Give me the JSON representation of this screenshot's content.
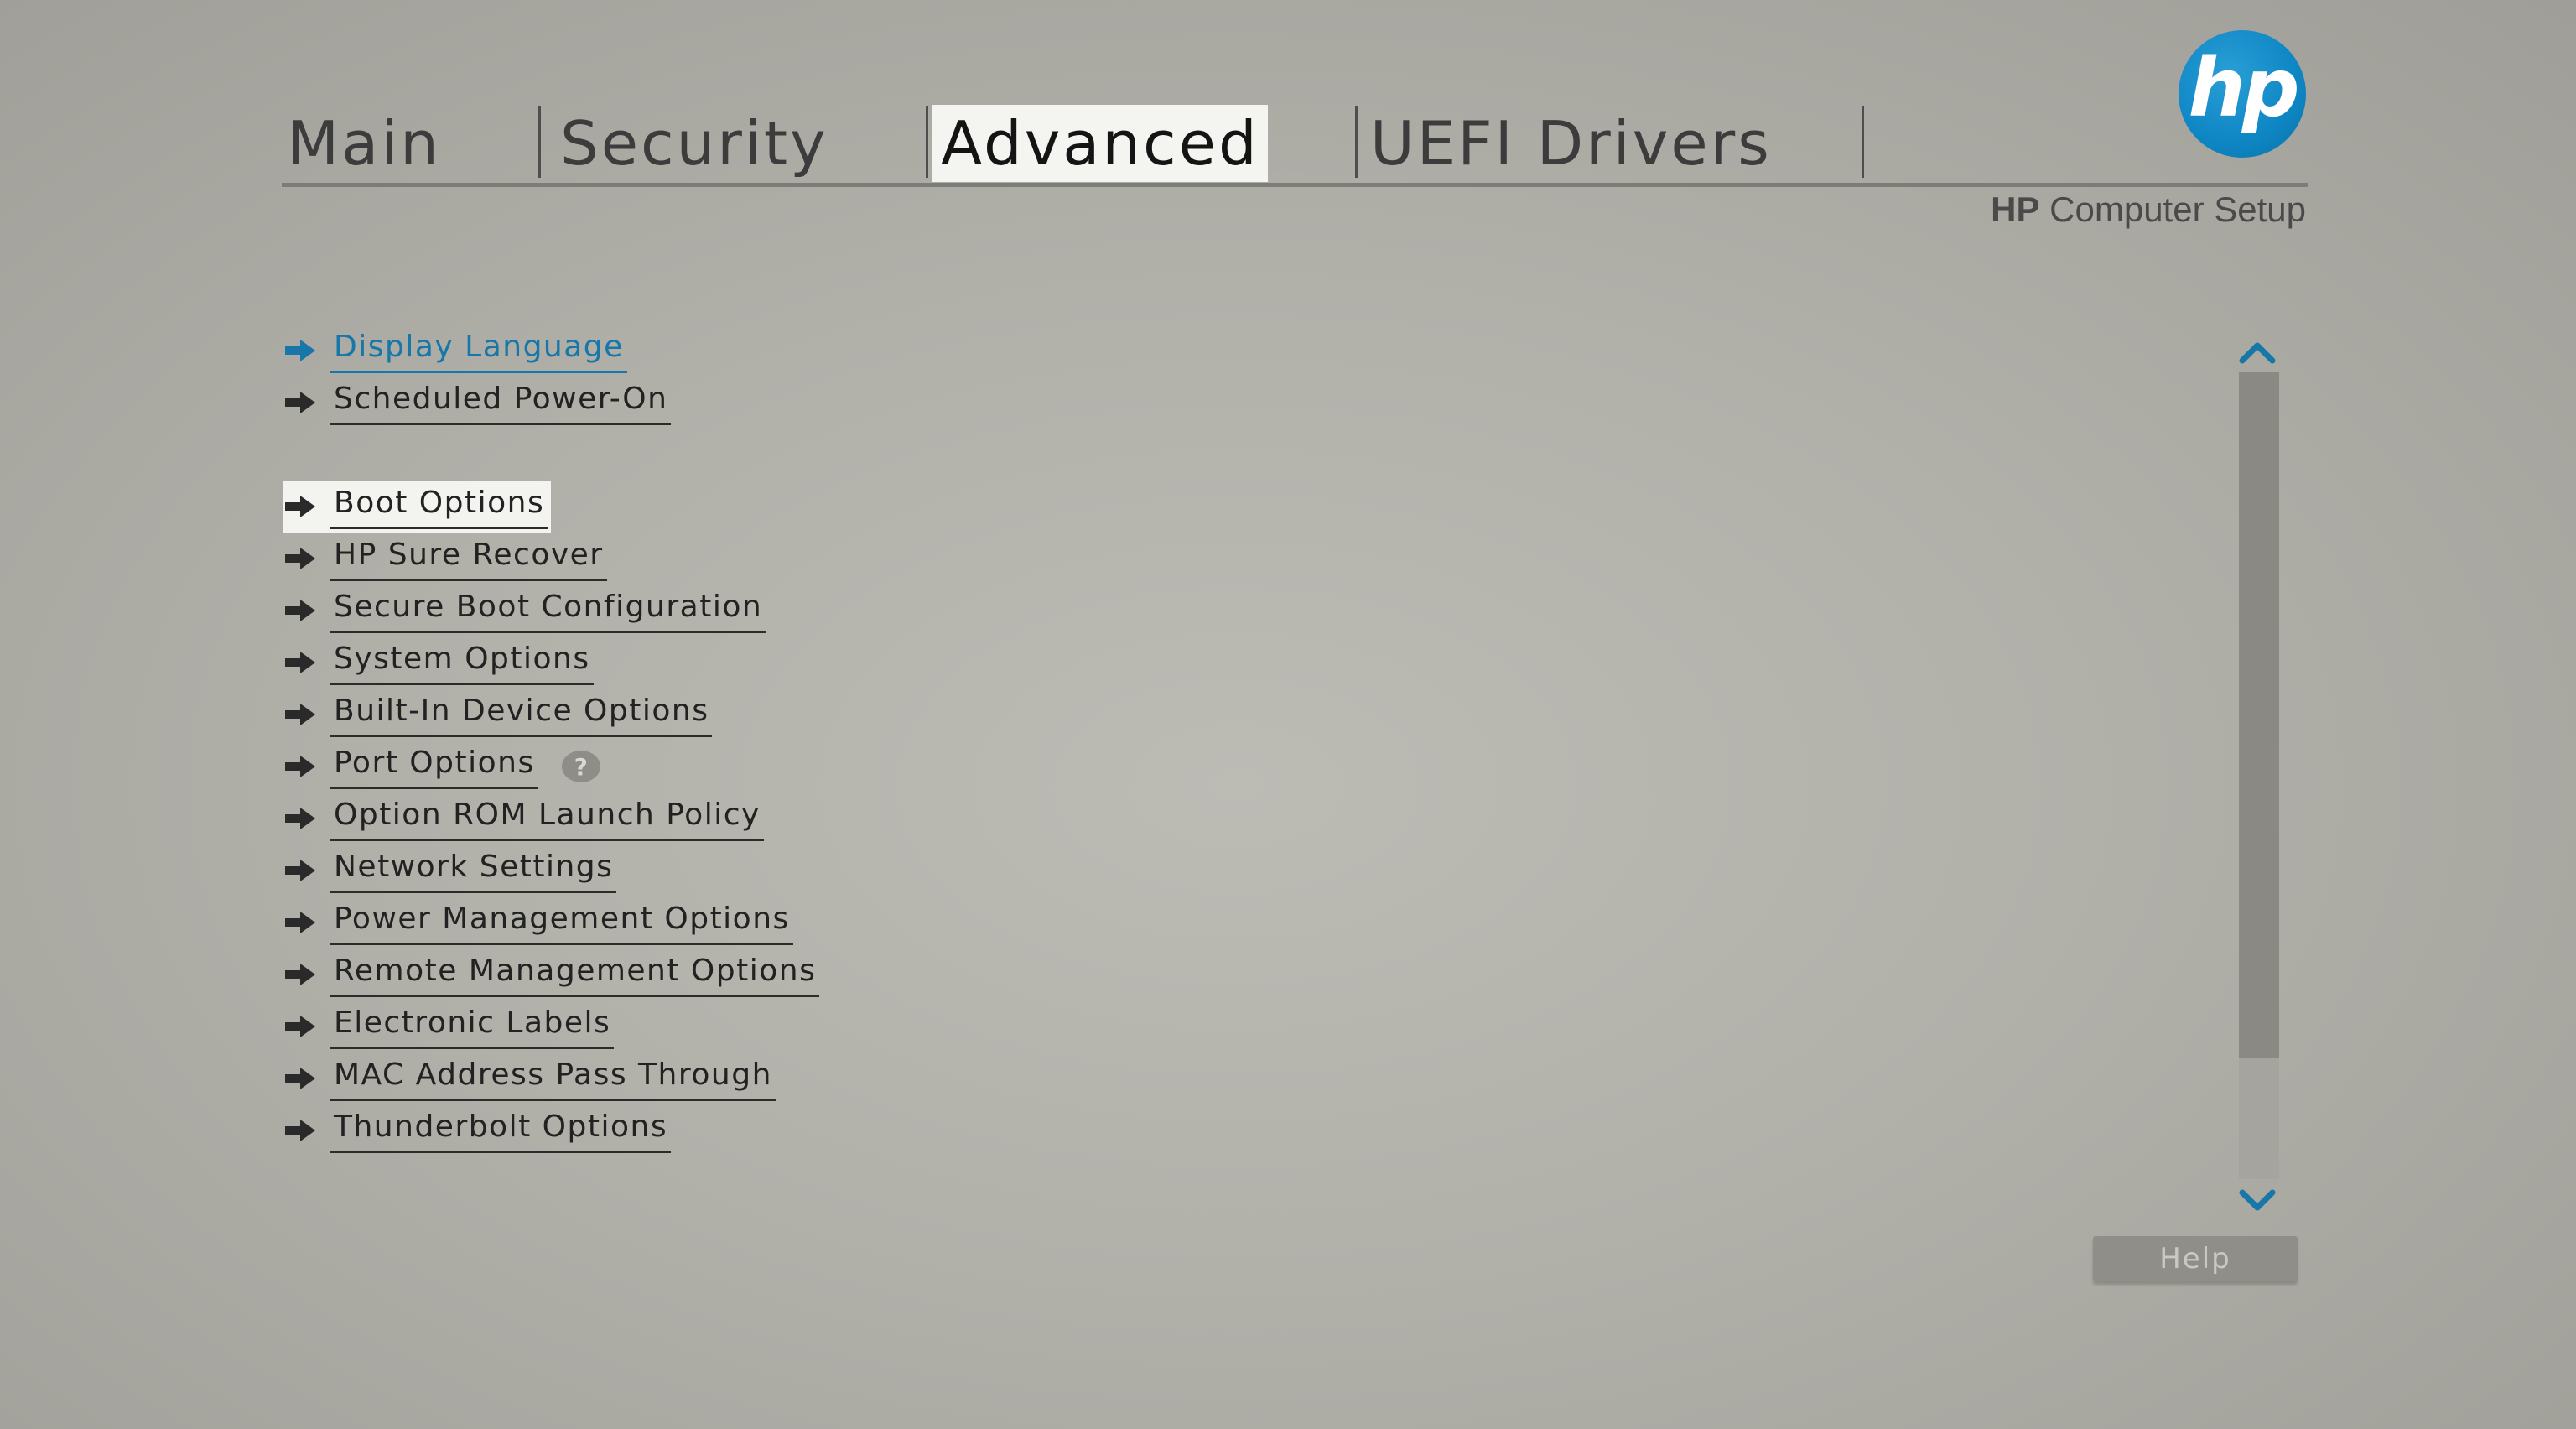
{
  "tabs": [
    {
      "label": "Main",
      "active": false
    },
    {
      "label": "Security",
      "active": false
    },
    {
      "label": "Advanced",
      "active": true
    },
    {
      "label": "UEFI Drivers",
      "active": false
    }
  ],
  "logo": {
    "text": "hp",
    "color": "#0e86c4"
  },
  "app_title": {
    "brand": "HP",
    "name": "Computer Setup"
  },
  "menu": {
    "items": [
      {
        "label": "Display Language",
        "state": "link"
      },
      {
        "label": "Scheduled Power-On",
        "state": "normal"
      },
      {
        "label": "Boot Options",
        "state": "selected"
      },
      {
        "label": "HP Sure Recover",
        "state": "normal"
      },
      {
        "label": "Secure Boot Configuration",
        "state": "normal"
      },
      {
        "label": "System Options",
        "state": "normal"
      },
      {
        "label": "Built-In Device Options",
        "state": "normal"
      },
      {
        "label": "Port Options",
        "state": "normal",
        "badge": "?"
      },
      {
        "label": "Option ROM Launch Policy",
        "state": "normal"
      },
      {
        "label": "Network Settings",
        "state": "normal"
      },
      {
        "label": "Power Management Options",
        "state": "normal"
      },
      {
        "label": "Remote Management Options",
        "state": "normal"
      },
      {
        "label": "Electronic Labels",
        "state": "normal"
      },
      {
        "label": "MAC Address Pass Through",
        "state": "normal"
      },
      {
        "label": "Thunderbolt Options",
        "state": "normal"
      }
    ]
  },
  "scrollbar": {
    "thumb_fraction": 0.85,
    "up_icon": "chevron-up-icon",
    "down_icon": "chevron-down-icon",
    "color": "#1677a8"
  },
  "help_button": {
    "label": "Help"
  },
  "colors": {
    "accent": "#1677a8",
    "selection": "#f3f3f0",
    "background": "#b5b4ad"
  }
}
